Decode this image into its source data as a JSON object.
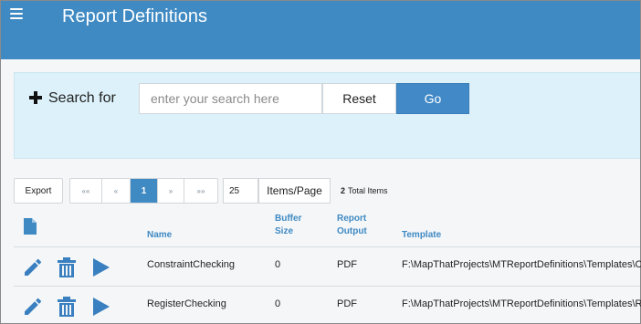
{
  "header": {
    "title": "Report Definitions",
    "menu_icon": "hamburger-menu-icon",
    "background": "#3f8ac3"
  },
  "search": {
    "icon": "plus-icon",
    "label": "Search for",
    "placeholder": "enter your search here",
    "value": "",
    "reset_label": "Reset",
    "go_label": "Go"
  },
  "toolbar": {
    "export_label": "Export",
    "pager": {
      "first": "««",
      "prev": "«",
      "current": "1",
      "next": "»",
      "last": "»»"
    },
    "page_size": "25",
    "items_page_label": "Items/Page",
    "total_count": "2",
    "total_label": "Total Items"
  },
  "table": {
    "header_icon": "document-icon",
    "columns": {
      "name": "Name",
      "buffer_size_1": "Buffer",
      "buffer_size_2": "Size",
      "report_output_1": "Report",
      "report_output_2": "Output",
      "template": "Template"
    },
    "rows": [
      {
        "name": "ConstraintChecking",
        "buffer_size": "0",
        "report_output": "PDF",
        "template": "F:\\MapThatProjects\\MTReportDefinitions\\Templates\\C"
      },
      {
        "name": "RegisterChecking",
        "buffer_size": "0",
        "report_output": "PDF",
        "template": "F:\\MapThatProjects\\MTReportDefinitions\\Templates\\R"
      }
    ],
    "row_actions": [
      "edit-pencil-icon",
      "trash-icon",
      "play-icon"
    ]
  },
  "colors": {
    "accent": "#3f8ac3",
    "search_panel": "#dcf1f9",
    "action_icon": "#3a7fbf"
  }
}
